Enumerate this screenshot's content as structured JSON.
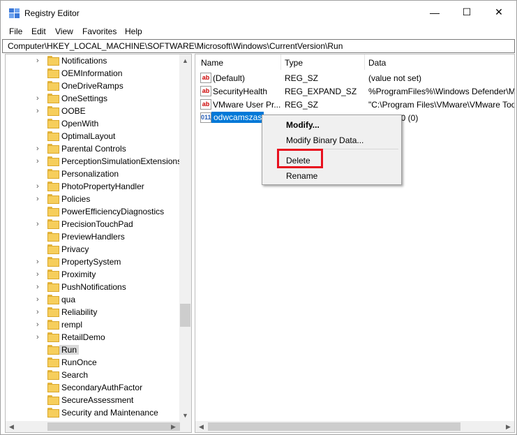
{
  "window": {
    "title": "Registry Editor",
    "minimize": "—",
    "maximize": "☐",
    "close": "✕"
  },
  "menu": [
    "File",
    "Edit",
    "View",
    "Favorites",
    "Help"
  ],
  "address": "Computer\\HKEY_LOCAL_MACHINE\\SOFTWARE\\Microsoft\\Windows\\CurrentVersion\\Run",
  "tree": {
    "items": [
      {
        "label": "Notifications",
        "expandable": true
      },
      {
        "label": "OEMInformation",
        "expandable": false
      },
      {
        "label": "OneDriveRamps",
        "expandable": false
      },
      {
        "label": "OneSettings",
        "expandable": true
      },
      {
        "label": "OOBE",
        "expandable": true
      },
      {
        "label": "OpenWith",
        "expandable": false
      },
      {
        "label": "OptimalLayout",
        "expandable": false
      },
      {
        "label": "Parental Controls",
        "expandable": true
      },
      {
        "label": "PerceptionSimulationExtensions",
        "expandable": true
      },
      {
        "label": "Personalization",
        "expandable": false
      },
      {
        "label": "PhotoPropertyHandler",
        "expandable": true
      },
      {
        "label": "Policies",
        "expandable": true
      },
      {
        "label": "PowerEfficiencyDiagnostics",
        "expandable": false
      },
      {
        "label": "PrecisionTouchPad",
        "expandable": true
      },
      {
        "label": "PreviewHandlers",
        "expandable": false
      },
      {
        "label": "Privacy",
        "expandable": false
      },
      {
        "label": "PropertySystem",
        "expandable": true
      },
      {
        "label": "Proximity",
        "expandable": true
      },
      {
        "label": "PushNotifications",
        "expandable": true
      },
      {
        "label": "qua",
        "expandable": true
      },
      {
        "label": "Reliability",
        "expandable": true
      },
      {
        "label": "rempl",
        "expandable": true
      },
      {
        "label": "RetailDemo",
        "expandable": true
      },
      {
        "label": "Run",
        "expandable": false,
        "selected": true
      },
      {
        "label": "RunOnce",
        "expandable": false
      },
      {
        "label": "Search",
        "expandable": false
      },
      {
        "label": "SecondaryAuthFactor",
        "expandable": false
      },
      {
        "label": "SecureAssessment",
        "expandable": false
      },
      {
        "label": "Security and Maintenance",
        "expandable": false
      }
    ]
  },
  "list": {
    "headers": {
      "name": "Name",
      "type": "Type",
      "data": "Data"
    },
    "rows": [
      {
        "icon": "ab",
        "name": "(Default)",
        "type": "REG_SZ",
        "data": "(value not set)"
      },
      {
        "icon": "ab",
        "name": "SecurityHealth",
        "type": "REG_EXPAND_SZ",
        "data": "%ProgramFiles%\\Windows Defender\\M"
      },
      {
        "icon": "ab",
        "name": "VMware User Pr...",
        "type": "REG_SZ",
        "data": "\"C:\\Program Files\\VMware\\VMware Too"
      },
      {
        "icon": "011",
        "name": "odwcamszas",
        "type": "",
        "data": "00 (0)",
        "selected": true
      }
    ]
  },
  "context_menu": {
    "modify": "Modify...",
    "modify_binary": "Modify Binary Data...",
    "delete": "Delete",
    "rename": "Rename"
  },
  "colors": {
    "selection": "#0078d7",
    "highlight_box": "#e8101e",
    "folder": "#f6ce5c"
  }
}
